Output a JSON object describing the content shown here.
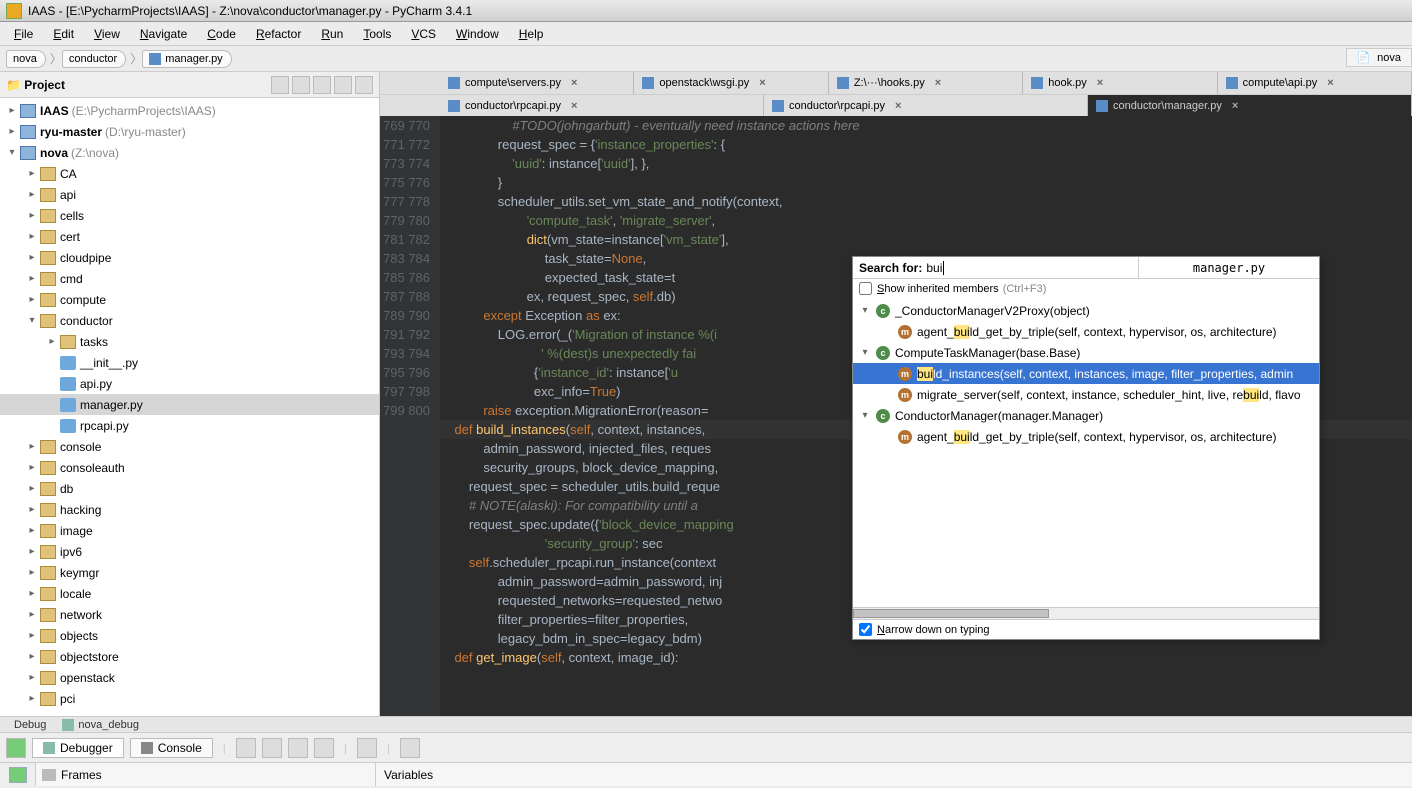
{
  "title": "IAAS - [E:\\PycharmProjects\\IAAS] - Z:\\nova\\conductor\\manager.py - PyCharm 3.4.1",
  "menu": [
    "File",
    "Edit",
    "View",
    "Navigate",
    "Code",
    "Refactor",
    "Run",
    "Tools",
    "VCS",
    "Window",
    "Help"
  ],
  "breadcrumbs": [
    "nova",
    "conductor",
    "manager.py"
  ],
  "right_nav": "nova",
  "project_panel_title": "Project",
  "tree": [
    {
      "d": 0,
      "tw": "▸",
      "ic": "mod",
      "bold": "IAAS",
      "grey": " (E:\\PycharmProjects\\IAAS)"
    },
    {
      "d": 0,
      "tw": "▸",
      "ic": "mod",
      "bold": "ryu-master",
      "grey": " (D:\\ryu-master)"
    },
    {
      "d": 0,
      "tw": "▾",
      "ic": "mod",
      "bold": "nova",
      "grey": " (Z:\\nova)"
    },
    {
      "d": 1,
      "tw": "▸",
      "ic": "fld",
      "lbl": "CA"
    },
    {
      "d": 1,
      "tw": "▸",
      "ic": "fld",
      "lbl": "api"
    },
    {
      "d": 1,
      "tw": "▸",
      "ic": "fld",
      "lbl": "cells"
    },
    {
      "d": 1,
      "tw": "▸",
      "ic": "fld",
      "lbl": "cert"
    },
    {
      "d": 1,
      "tw": "▸",
      "ic": "fld",
      "lbl": "cloudpipe"
    },
    {
      "d": 1,
      "tw": "▸",
      "ic": "fld",
      "lbl": "cmd"
    },
    {
      "d": 1,
      "tw": "▸",
      "ic": "fld",
      "lbl": "compute"
    },
    {
      "d": 1,
      "tw": "▾",
      "ic": "fld",
      "lbl": "conductor"
    },
    {
      "d": 2,
      "tw": "▸",
      "ic": "fld",
      "lbl": "tasks"
    },
    {
      "d": 2,
      "tw": "",
      "ic": "py",
      "lbl": "__init__.py"
    },
    {
      "d": 2,
      "tw": "",
      "ic": "py",
      "lbl": "api.py"
    },
    {
      "d": 2,
      "tw": "",
      "ic": "py",
      "lbl": "manager.py",
      "sel": true
    },
    {
      "d": 2,
      "tw": "",
      "ic": "py",
      "lbl": "rpcapi.py"
    },
    {
      "d": 1,
      "tw": "▸",
      "ic": "fld",
      "lbl": "console"
    },
    {
      "d": 1,
      "tw": "▸",
      "ic": "fld",
      "lbl": "consoleauth"
    },
    {
      "d": 1,
      "tw": "▸",
      "ic": "fld",
      "lbl": "db"
    },
    {
      "d": 1,
      "tw": "▸",
      "ic": "fld",
      "lbl": "hacking"
    },
    {
      "d": 1,
      "tw": "▸",
      "ic": "fld",
      "lbl": "image"
    },
    {
      "d": 1,
      "tw": "▸",
      "ic": "fld",
      "lbl": "ipv6"
    },
    {
      "d": 1,
      "tw": "▸",
      "ic": "fld",
      "lbl": "keymgr"
    },
    {
      "d": 1,
      "tw": "▸",
      "ic": "fld",
      "lbl": "locale"
    },
    {
      "d": 1,
      "tw": "▸",
      "ic": "fld",
      "lbl": "network"
    },
    {
      "d": 1,
      "tw": "▸",
      "ic": "fld",
      "lbl": "objects"
    },
    {
      "d": 1,
      "tw": "▸",
      "ic": "fld",
      "lbl": "objectstore"
    },
    {
      "d": 1,
      "tw": "▸",
      "ic": "fld",
      "lbl": "openstack"
    },
    {
      "d": 1,
      "tw": "▸",
      "ic": "fld",
      "lbl": "pci"
    }
  ],
  "tabs_row1": [
    {
      "label": "compute\\servers.py",
      "closable": true
    },
    {
      "label": "openstack\\wsgi.py",
      "closable": true
    },
    {
      "label": "Z:\\···\\hooks.py",
      "closable": true
    },
    {
      "label": "hook.py",
      "closable": true
    },
    {
      "label": "compute\\api.py",
      "closable": true
    }
  ],
  "tabs_row2": [
    {
      "label": "conductor\\rpcapi.py",
      "closable": true
    },
    {
      "label": "conductor\\rpcapi.py",
      "closable": true
    },
    {
      "label": "conductor\\manager.py",
      "closable": true,
      "active": true
    }
  ],
  "gutter_start": 769,
  "gutter_end": 800,
  "code_lines": [
    {
      "t": "                    #TODO(johngarbutt) - eventually need instance actions here",
      "cls": "c"
    },
    {
      "t": "                request_spec = {'instance_properties': {",
      "seg": [
        [
          "                ",
          ""
        ],
        [
          "request_spec = {",
          ""
        ],
        [
          "'instance_properties'",
          "s"
        ],
        [
          ": {",
          ""
        ]
      ]
    },
    {
      "t": "                    'uuid': instance['uuid'], },",
      "seg": [
        [
          "                    ",
          ""
        ],
        [
          "'uuid'",
          "s"
        ],
        [
          ": instance[",
          ""
        ],
        [
          "'uuid'",
          "s"
        ],
        [
          "], },",
          ""
        ]
      ]
    },
    {
      "t": "                }",
      "seg": [
        [
          "                }",
          ""
        ]
      ]
    },
    {
      "t": "                scheduler_utils.set_vm_state_and_notify(context,",
      "seg": [
        [
          "                scheduler_utils.set_vm_state_and_notify(context,",
          ""
        ]
      ]
    },
    {
      "t": "                        'compute_task', 'migrate_server',",
      "seg": [
        [
          "                        ",
          ""
        ],
        [
          "'compute_task'",
          "s"
        ],
        [
          ", ",
          ""
        ],
        [
          "'migrate_server'",
          "s"
        ],
        [
          ",",
          ""
        ]
      ]
    },
    {
      "t": "                        dict(vm_state=instance['vm_state'],",
      "seg": [
        [
          "                        ",
          ""
        ],
        [
          "dict",
          "fn"
        ],
        [
          "(vm_state=instance[",
          ""
        ],
        [
          "'vm_state'",
          "s"
        ],
        [
          "],",
          ""
        ]
      ]
    },
    {
      "t": "                             task_state=None,",
      "seg": [
        [
          "                             task_state=",
          ""
        ],
        [
          "None",
          "kw"
        ],
        [
          ",",
          ""
        ]
      ]
    },
    {
      "t": "                             expected_task_state=t",
      "seg": [
        [
          "                             expected_task_state=t",
          ""
        ]
      ]
    },
    {
      "t": "                        ex, request_spec, self.db)",
      "seg": [
        [
          "                        ex, request_spec, ",
          ""
        ],
        [
          "self",
          "kw"
        ],
        [
          ".db)",
          ""
        ]
      ]
    },
    {
      "t": "            except Exception as ex:",
      "seg": [
        [
          "            ",
          ""
        ],
        [
          "except",
          "kw"
        ],
        [
          " Exception ",
          ""
        ],
        [
          "as",
          "kw"
        ],
        [
          " ex:",
          ""
        ]
      ]
    },
    {
      "t": "                LOG.error(_('Migration of instance %(i",
      "seg": [
        [
          "                LOG.error(_(",
          ""
        ],
        [
          "'Migration of instance %(i",
          "s"
        ]
      ]
    },
    {
      "t": "                            ' %(dest)s unexpectedly fai",
      "seg": [
        [
          "                            ",
          ""
        ],
        [
          "' %(dest)s unexpectedly fai",
          "s"
        ]
      ]
    },
    {
      "t": "                          {'instance_id': instance['u",
      "seg": [
        [
          "                          {",
          ""
        ],
        [
          "'instance_id'",
          "s"
        ],
        [
          ": instance[",
          ""
        ],
        [
          "'u",
          "s"
        ]
      ]
    },
    {
      "t": "                          exc_info=True)",
      "seg": [
        [
          "                          exc_info=",
          ""
        ],
        [
          "True",
          "kw"
        ],
        [
          ")",
          ""
        ]
      ]
    },
    {
      "t": "            raise exception.MigrationError(reason=",
      "seg": [
        [
          "            ",
          ""
        ],
        [
          "raise",
          "kw"
        ],
        [
          " exception.MigrationError(reason=",
          ""
        ]
      ]
    },
    {
      "t": "",
      "seg": [
        [
          "",
          ""
        ]
      ]
    },
    {
      "t": "    def build_instances(self, context, instances,",
      "seg": [
        [
          "    ",
          ""
        ],
        [
          "def",
          "kw"
        ],
        [
          " ",
          ""
        ],
        [
          "build_instances",
          "fn"
        ],
        [
          "(",
          ""
        ],
        [
          "self",
          "kw"
        ],
        [
          ", context, instances,",
          ""
        ]
      ],
      "hl": true
    },
    {
      "t": "            admin_password, injected_files, reques",
      "seg": [
        [
          "            admin_password, injected_files, reques",
          ""
        ]
      ]
    },
    {
      "t": "            security_groups, block_device_mapping,",
      "seg": [
        [
          "            security_groups, block_device_mapping,",
          ""
        ]
      ]
    },
    {
      "t": "        request_spec = scheduler_utils.build_reque",
      "seg": [
        [
          "        request_spec = scheduler_utils.build_reque",
          ""
        ]
      ]
    },
    {
      "t": "",
      "seg": [
        [
          "",
          ""
        ]
      ]
    },
    {
      "t": "        # NOTE(alaski): For compatibility until a ",
      "cls": "c"
    },
    {
      "t": "        request_spec.update({'block_device_mapping",
      "seg": [
        [
          "        request_spec.update({",
          ""
        ],
        [
          "'block_device_mapping",
          "s"
        ]
      ]
    },
    {
      "t": "                             'security_group': sec",
      "seg": [
        [
          "                             ",
          ""
        ],
        [
          "'security_group'",
          "s"
        ],
        [
          ": sec",
          ""
        ]
      ]
    },
    {
      "t": "        self.scheduler_rpcapi.run_instance(context",
      "seg": [
        [
          "        ",
          ""
        ],
        [
          "self",
          "kw"
        ],
        [
          ".scheduler_rpcapi.run_instance(context",
          ""
        ]
      ]
    },
    {
      "t": "                admin_password=admin_password, inj",
      "seg": [
        [
          "                admin_password=admin_password, inj",
          ""
        ]
      ]
    },
    {
      "t": "                requested_networks=requested_netwo",
      "seg": [
        [
          "                requested_networks=requested_netwo",
          ""
        ]
      ]
    },
    {
      "t": "                filter_properties=filter_properties,",
      "seg": [
        [
          "                filter_properties=filter_properties,",
          ""
        ]
      ]
    },
    {
      "t": "                legacy_bdm_in_spec=legacy_bdm)",
      "seg": [
        [
          "                legacy_bdm_in_spec=legacy_bdm)",
          ""
        ]
      ]
    },
    {
      "t": "",
      "seg": [
        [
          "",
          ""
        ]
      ]
    },
    {
      "t": "    def get_image(self, context, image_id):",
      "seg": [
        [
          "    ",
          ""
        ],
        [
          "def",
          "kw"
        ],
        [
          " ",
          ""
        ],
        [
          "get_image",
          "fn"
        ],
        [
          "(",
          ""
        ],
        [
          "self",
          "kw"
        ],
        [
          ", context, image_id):",
          ""
        ]
      ]
    }
  ],
  "popup": {
    "search_label": "Search for:",
    "search_value": "bui",
    "file": "manager.py",
    "inherited_label": "Show inherited members",
    "inherited_hint": "(Ctrl+F3)",
    "narrow_label": "Narrow down on typing",
    "nodes": [
      {
        "d": 0,
        "tw": "▾",
        "ic": "c",
        "pre": "_ConductorManagerV2Proxy",
        "post": "(object)"
      },
      {
        "d": 1,
        "tw": "",
        "ic": "m",
        "pre": "agent_",
        "hl": "bui",
        "post": "ld_get_by_triple(self, context, hypervisor, os, architecture)"
      },
      {
        "d": 0,
        "tw": "▾",
        "ic": "c",
        "pre": "ComputeTaskManager",
        "post": "(base.Base)"
      },
      {
        "d": 1,
        "tw": "",
        "ic": "m",
        "pre": "",
        "hl": "bui",
        "post": "ld_instances(self, context, instances, image, filter_properties, admin",
        "sel": true
      },
      {
        "d": 1,
        "tw": "",
        "ic": "m",
        "pre": "migrate_server(self, context, instance, scheduler_hint, live, re",
        "hl": "bui",
        "post": "ld, flavo"
      },
      {
        "d": 0,
        "tw": "▾",
        "ic": "c",
        "pre": "ConductorManager",
        "post": "(manager.Manager)"
      },
      {
        "d": 1,
        "tw": "",
        "ic": "m",
        "pre": "agent_",
        "hl": "bui",
        "post": "ld_get_by_triple(self, context, hypervisor, os, architecture)"
      }
    ]
  },
  "bottom_tabs": [
    "Debug",
    "nova_debug"
  ],
  "debugger_tabs": [
    "Debugger",
    "Console"
  ],
  "frames_label": "Frames",
  "variables_label": "Variables"
}
